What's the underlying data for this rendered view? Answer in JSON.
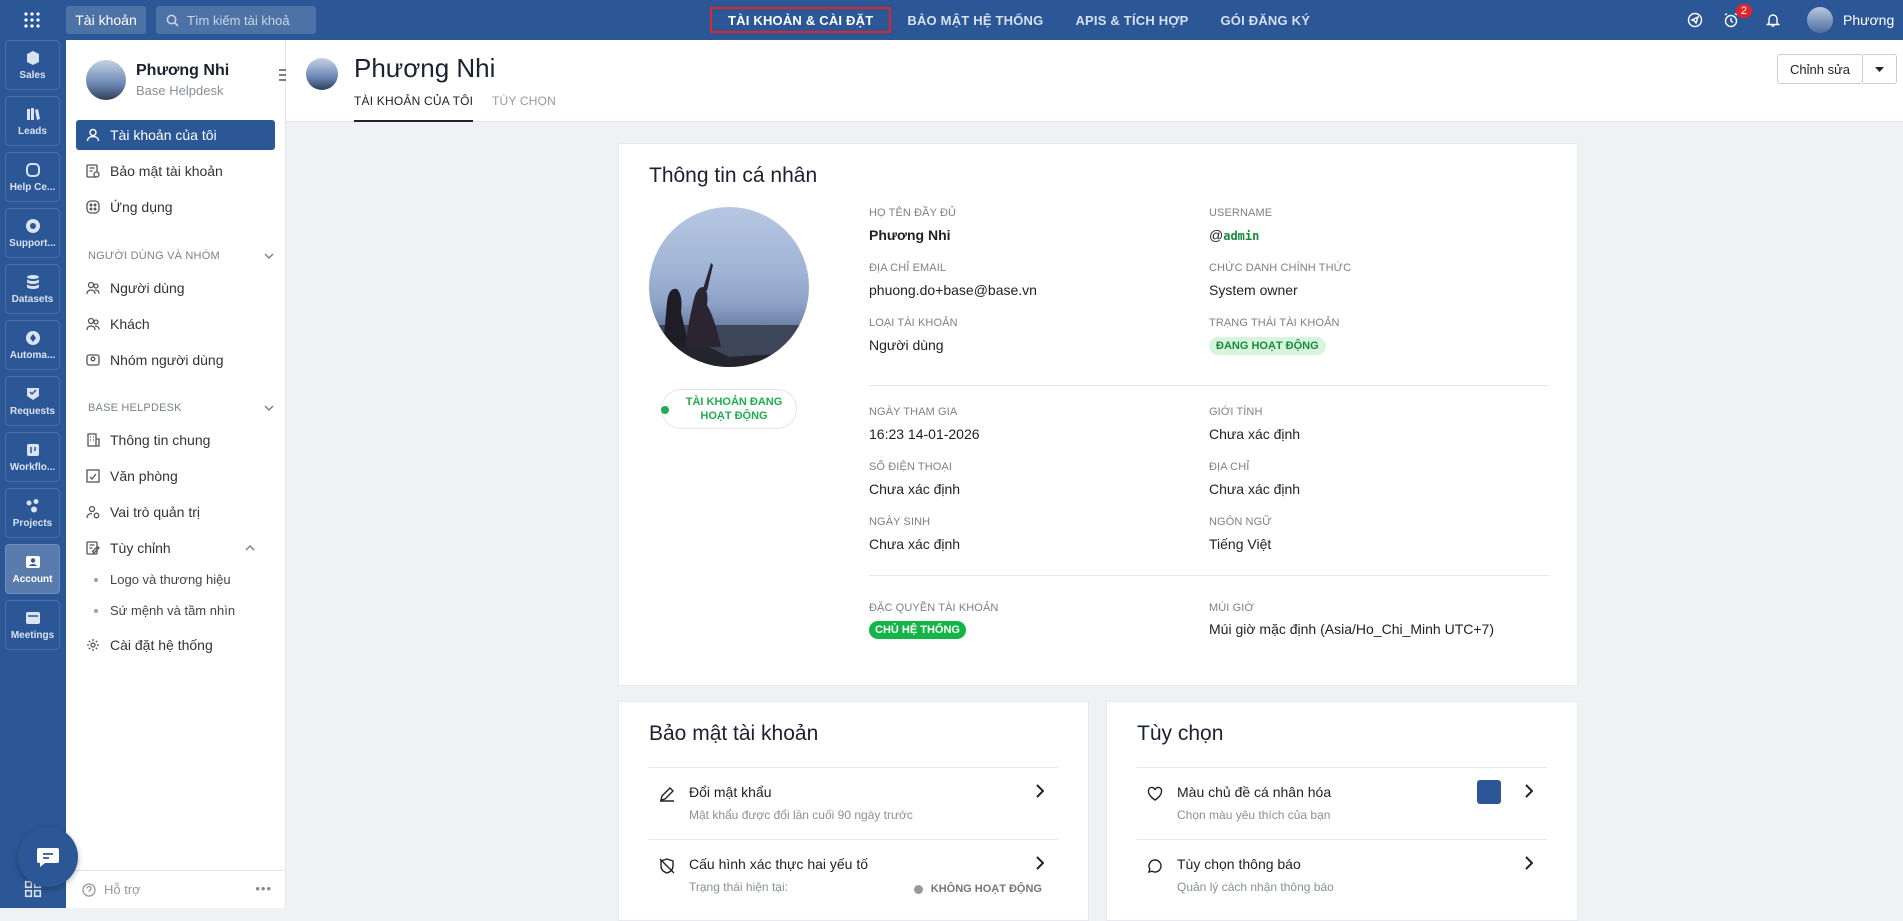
{
  "topbar": {
    "account_chip": "Tài khoản",
    "search_placeholder": "Tìm kiếm tài khoả",
    "nav": [
      "TÀI KHOẢN & CÀI ĐẶT",
      "BẢO MẬT HỆ THỐNG",
      "APIS & TÍCH HỢP",
      "GÓI ĐĂNG KÝ"
    ],
    "notification_count": "2",
    "user_name": "Phương"
  },
  "rail": {
    "items": [
      "Sales",
      "Leads",
      "Help Ce...",
      "Support...",
      "Datasets",
      "Automa...",
      "Requests",
      "Workflo...",
      "Projects",
      "Account",
      "Meetings"
    ],
    "active": "Account"
  },
  "sidebar": {
    "name": "Phương Nhi",
    "subtitle": "Base Helpdesk",
    "items": [
      "Tài khoản của tôi",
      "Bảo mật tài khoản",
      "Ứng dụng"
    ],
    "section_users": "NGƯỜI DÙNG VÀ NHÓM",
    "users_items": [
      "Người dùng",
      "Khách",
      "Nhóm người dùng"
    ],
    "section_base": "BASE HELPDESK",
    "base_items": [
      "Thông tin chung",
      "Văn phòng",
      "Vai trò quản trị",
      "Tùy chỉnh"
    ],
    "custom_sub": [
      "Logo và thương hiệu",
      "Sứ mệnh và tầm nhìn"
    ],
    "system_settings": "Cài đặt hệ thống",
    "footer_help": "Hỗ trợ"
  },
  "header": {
    "title": "Phương Nhi",
    "tabs": [
      "TÀI KHOẢN CỦA TÔI",
      "TÙY CHỌN"
    ],
    "edit_label": "Chỉnh sửa"
  },
  "profile": {
    "title": "Thông tin cá nhân",
    "status_chip": "TÀI KHOẢN ĐANG HOẠT ĐỘNG",
    "fields": {
      "full_name_label": "HỌ TÊN ĐẦY ĐỦ",
      "full_name": "Phương Nhi",
      "username_label": "USERNAME",
      "username_at": "@",
      "username": "admin",
      "email_label": "ĐỊA CHỈ EMAIL",
      "email": "phuong.do+base@base.vn",
      "job_title_label": "CHỨC DANH CHÍNH THỨC",
      "job_title": "System owner",
      "account_type_label": "LOẠI TÀI KHOẢN",
      "account_type": "Người dùng",
      "account_status_label": "TRẠNG THÁI TÀI KHOẢN",
      "account_status": "ĐANG HOẠT ĐỘNG",
      "join_date_label": "NGÀY THAM GIA",
      "join_date": "16:23 14-01-2026",
      "gender_label": "GIỚI TÍNH",
      "gender": "Chưa xác định",
      "phone_label": "SỐ ĐIỆN THOẠI",
      "phone": "Chưa xác định",
      "address_label": "ĐỊA CHỈ",
      "address": "Chưa xác định",
      "birthday_label": "NGÀY SINH",
      "birthday": "Chưa xác định",
      "language_label": "NGÔN NGỮ",
      "language": "Tiếng Việt",
      "privilege_label": "ĐẶC QUYỀN TÀI KHOẢN",
      "privilege": "CHỦ HỆ THỐNG",
      "timezone_label": "MÚI GIỜ",
      "timezone": "Múi giờ mặc định (Asia/Ho_Chi_Minh UTC+7)"
    }
  },
  "security": {
    "title": "Bảo mật tài khoản",
    "change_password": "Đổi mật khẩu",
    "change_password_sub": "Mật khẩu được đổi lần cuối 90 ngày trước",
    "two_factor": "Cấu hình xác thực hai yếu tố",
    "two_factor_sub": "Trạng thái hiện tại:",
    "two_factor_state": "KHÔNG HOẠT ĐỘNG"
  },
  "options": {
    "title": "Tùy chọn",
    "theme": "Màu chủ đề cá nhân hóa",
    "theme_sub": "Chọn màu yêu thích của bạn",
    "theme_color": "#2b5796",
    "notify": "Tùy chọn thông báo",
    "notify_sub": "Quản lý cách nhận thông báo"
  }
}
